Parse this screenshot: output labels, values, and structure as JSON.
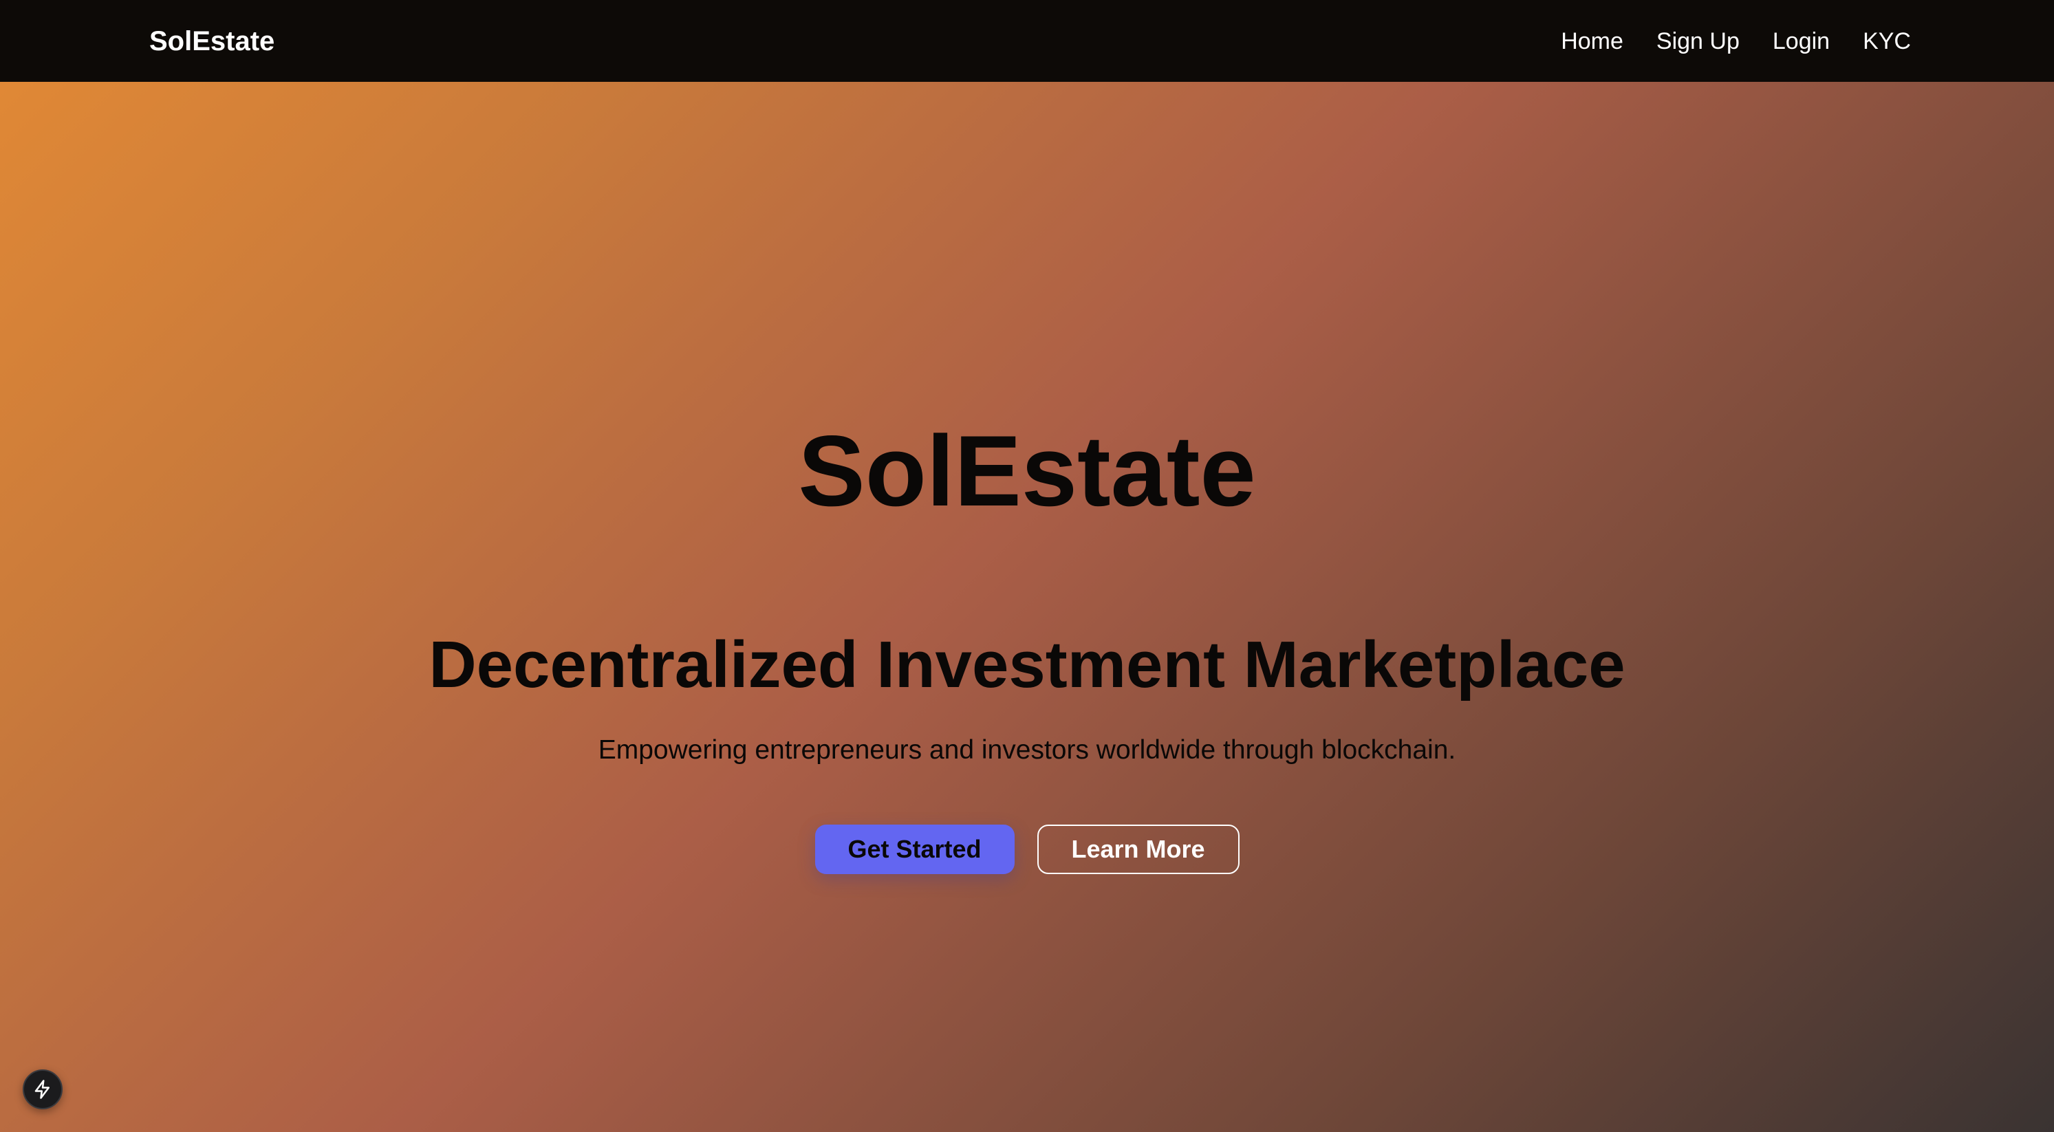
{
  "navbar": {
    "brand": "SolEstate",
    "links": [
      {
        "label": "Home"
      },
      {
        "label": "Sign Up"
      },
      {
        "label": "Login"
      },
      {
        "label": "KYC"
      }
    ]
  },
  "hero": {
    "title": "SolEstate",
    "subtitle": "Decentralized Investment Marketplace",
    "tagline": "Empowering entrepreneurs and investors worldwide through blockchain.",
    "primary_button": "Get Started",
    "secondary_button": "Learn More"
  },
  "floating_button": {
    "icon": "lightning-bolt-icon"
  },
  "colors": {
    "navbar_background": "#0d0a07",
    "gradient_start": "#e38a35",
    "gradient_mid": "#ab5e47",
    "gradient_end": "#3a3332",
    "primary_button": "#6366f1",
    "text_dark": "#0a0807",
    "text_light": "#ffffff"
  }
}
